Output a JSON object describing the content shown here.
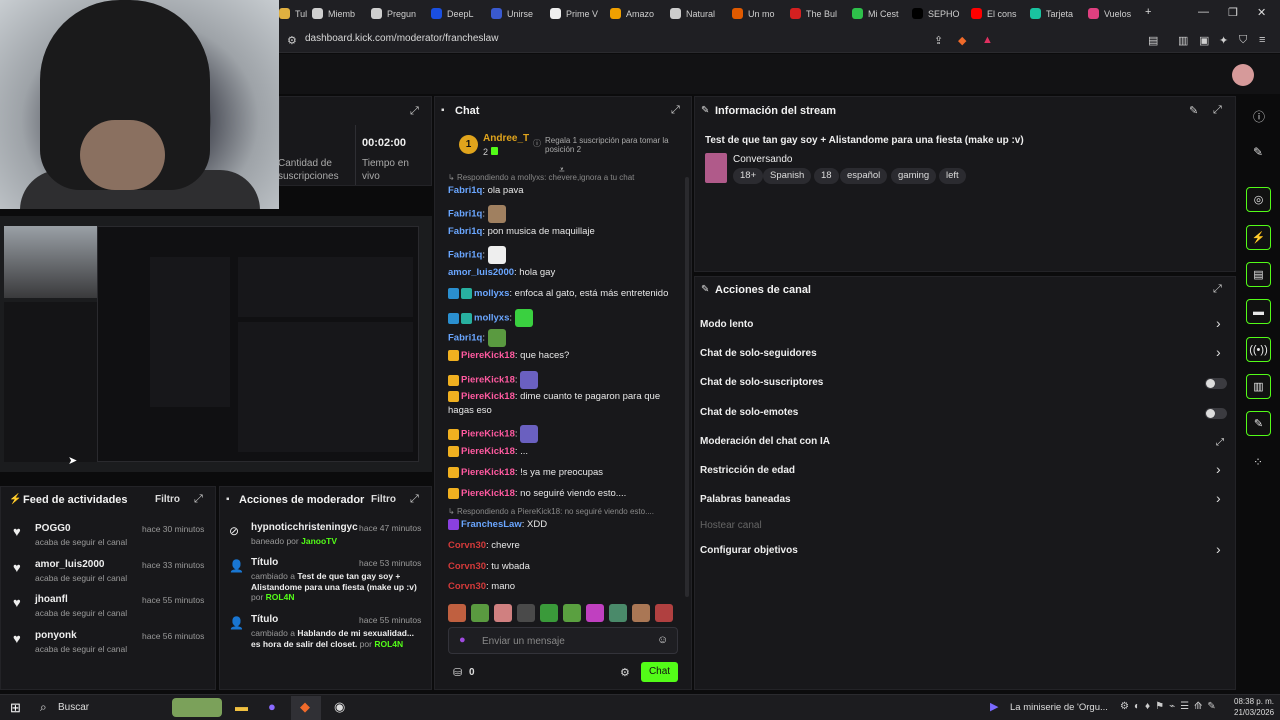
{
  "browser": {
    "tabs": [
      {
        "label": "Tul",
        "color": "#e0b040"
      },
      {
        "label": "Miemb",
        "color": "#cfcfcf"
      },
      {
        "label": "Pregun",
        "color": "#cfcfcf"
      },
      {
        "label": "DeepL",
        "color": "#1a4fe0"
      },
      {
        "label": "Unirse",
        "color": "#3a5ad0"
      },
      {
        "label": "Prime V",
        "color": "#eeeeee"
      },
      {
        "label": "Amazo",
        "color": "#f0a000"
      },
      {
        "label": "Natural",
        "color": "#cccccc"
      },
      {
        "label": "Un mo",
        "color": "#e05a00"
      },
      {
        "label": "The Bul",
        "color": "#d42020"
      },
      {
        "label": "Mi Cest",
        "color": "#2ec04a"
      },
      {
        "label": "SEPHO",
        "color": "#000000"
      },
      {
        "label": "El cons",
        "color": "#ff0000"
      },
      {
        "label": "Tarjeta",
        "color": "#19c3a0"
      },
      {
        "label": "Vuelos",
        "color": "#e04080"
      }
    ],
    "new_tab": "+",
    "url": "dashboard.kick.com/moderator/francheslaw"
  },
  "stats": {
    "subs_label": "Cantidad de suscripciones",
    "time_value": "00:02:00",
    "time_label": "Tiempo en vivo"
  },
  "chat": {
    "title": "Chat",
    "leader_rank": "1",
    "leader_name": "Andree_T",
    "leader_count": "2",
    "leader_hint": "Regala 1 suscripción para tomar la posición 2",
    "reply_top": "Respondiendo a mollyxs: chevere,ignora a tu chat",
    "messages": [
      {
        "user": "Fabri1q",
        "cls": "u-blue",
        "text": "ola pava"
      },
      {
        "user": "Fabri1q",
        "cls": "u-blue",
        "text": "",
        "emote": "#a08060"
      },
      {
        "user": "Fabri1q",
        "cls": "u-blue",
        "text": "pon musica de maquillaje"
      },
      {
        "user": "Fabri1q",
        "cls": "u-blue",
        "text": "",
        "emote": "#eeeeee"
      },
      {
        "user": "amor_luis2000",
        "cls": "u-blue",
        "text": "hola gay"
      },
      {
        "user": "mollyxs",
        "cls": "u-blue",
        "text": "enfoca al gato, está más entretenido",
        "badges": [
          "#2a8fd0",
          "#28b0a0"
        ]
      },
      {
        "user": "mollyxs",
        "cls": "u-blue",
        "text": "",
        "emote": "#3ad040",
        "badges": [
          "#2a8fd0",
          "#28b0a0"
        ]
      },
      {
        "user": "Fabri1q",
        "cls": "u-blue",
        "text": "",
        "emote": "#5a9a40"
      },
      {
        "user": "PiereKick18",
        "cls": "u-pink",
        "text": "que haces?",
        "badges": [
          "#f0b020"
        ]
      },
      {
        "user": "PiereKick18",
        "cls": "u-pink",
        "text": "",
        "emote": "#6a60c0",
        "badges": [
          "#f0b020"
        ]
      },
      {
        "user": "PiereKick18",
        "cls": "u-pink",
        "text": "dime cuanto te pagaron para que",
        "badges": [
          "#f0b020"
        ]
      },
      {
        "user": "",
        "cls": "",
        "text": "hagas eso"
      },
      {
        "user": "PiereKick18",
        "cls": "u-pink",
        "text": "",
        "emote": "#6a60c0",
        "badges": [
          "#f0b020"
        ]
      },
      {
        "user": "PiereKick18",
        "cls": "u-pink",
        "text": "...",
        "badges": [
          "#f0b020"
        ]
      },
      {
        "user": "PiereKick18",
        "cls": "u-pink",
        "text": "!s ya me preocupas",
        "badges": [
          "#f0b020"
        ]
      },
      {
        "user": "PiereKick18",
        "cls": "u-pink",
        "text": "no seguiré viendo esto....",
        "badges": [
          "#f0b020"
        ]
      }
    ],
    "reply_bottom": "Respondiendo a PiereKick18: no seguiré viendo esto....",
    "messages2": [
      {
        "user": "FranchesLaw",
        "cls": "u-blue",
        "text": "XDD",
        "badges": [
          "#8a40e0"
        ]
      },
      {
        "user": "Corvn30",
        "cls": "u-red",
        "text": "chevre"
      },
      {
        "user": "Corvn30",
        "cls": "u-red",
        "text": "tu wbada"
      },
      {
        "user": "Corvn30",
        "cls": "u-red",
        "text": "mano"
      }
    ],
    "input_placeholder": "Enviar un mensaje",
    "points": "0",
    "send_label": "Chat"
  },
  "stream_info": {
    "title": "Información del stream",
    "stream_title": "Test de que tan gay soy + Alistandome para una fiesta (make up :v)",
    "category": "Conversando",
    "tags": [
      "18+",
      "Spanish",
      "18",
      "español",
      "gaming",
      "left"
    ]
  },
  "channel_actions": {
    "title": "Acciones de canal",
    "items": [
      {
        "label": "Modo lento",
        "ctl": "chev"
      },
      {
        "label": "Chat de solo-seguidores",
        "ctl": "chev"
      },
      {
        "label": "Chat de solo-suscriptores",
        "ctl": "toggle"
      },
      {
        "label": "Chat de solo-emotes",
        "ctl": "toggle"
      },
      {
        "label": "Moderación del chat con IA",
        "ctl": "ext"
      },
      {
        "label": "Restricción de edad",
        "ctl": "chev"
      },
      {
        "label": "Palabras baneadas",
        "ctl": "chev"
      },
      {
        "label": "Hostear canal",
        "ctl": "none"
      },
      {
        "label": "Configurar objetivos",
        "ctl": "chev"
      }
    ]
  },
  "activity": {
    "title": "Feed de actividades",
    "filter": "Filtro",
    "items": [
      {
        "name": "POGG0",
        "sub": "acaba de seguir el canal",
        "time": "hace 30 minutos"
      },
      {
        "name": "amor_luis2000",
        "sub": "acaba de seguir el canal",
        "time": "hace 33 minutos"
      },
      {
        "name": "jhoanfl",
        "sub": "acaba de seguir el canal",
        "time": "hace 55 minutos"
      },
      {
        "name": "ponyonk",
        "sub": "acaba de seguir el canal",
        "time": "hace 56 minutos"
      }
    ]
  },
  "mod_actions": {
    "title": "Acciones de moderador",
    "filter": "Filtro",
    "items": [
      {
        "name": "hypnoticchristeningyc",
        "time": "hace 47 minutos",
        "prefix": "baneado por",
        "value": "",
        "by": "JanooTV"
      },
      {
        "name": "Título",
        "time": "hace 53 minutos",
        "prefix": "cambiado a",
        "value": "Test de que tan gay soy + Alistandome para una fiesta (make up :v)",
        "by": "ROL4N"
      },
      {
        "name": "Título",
        "time": "hace 55 minutos",
        "prefix": "cambiado a",
        "value": "Hablando de mi sexualidad... es hora de salir del closet.",
        "by": "ROL4N"
      }
    ],
    "by_word": "por"
  },
  "taskbar": {
    "search": "Buscar",
    "now_playing": "La miniserie de 'Orgu...",
    "time": "08:38 p. m.",
    "date": "21/03/2026"
  }
}
